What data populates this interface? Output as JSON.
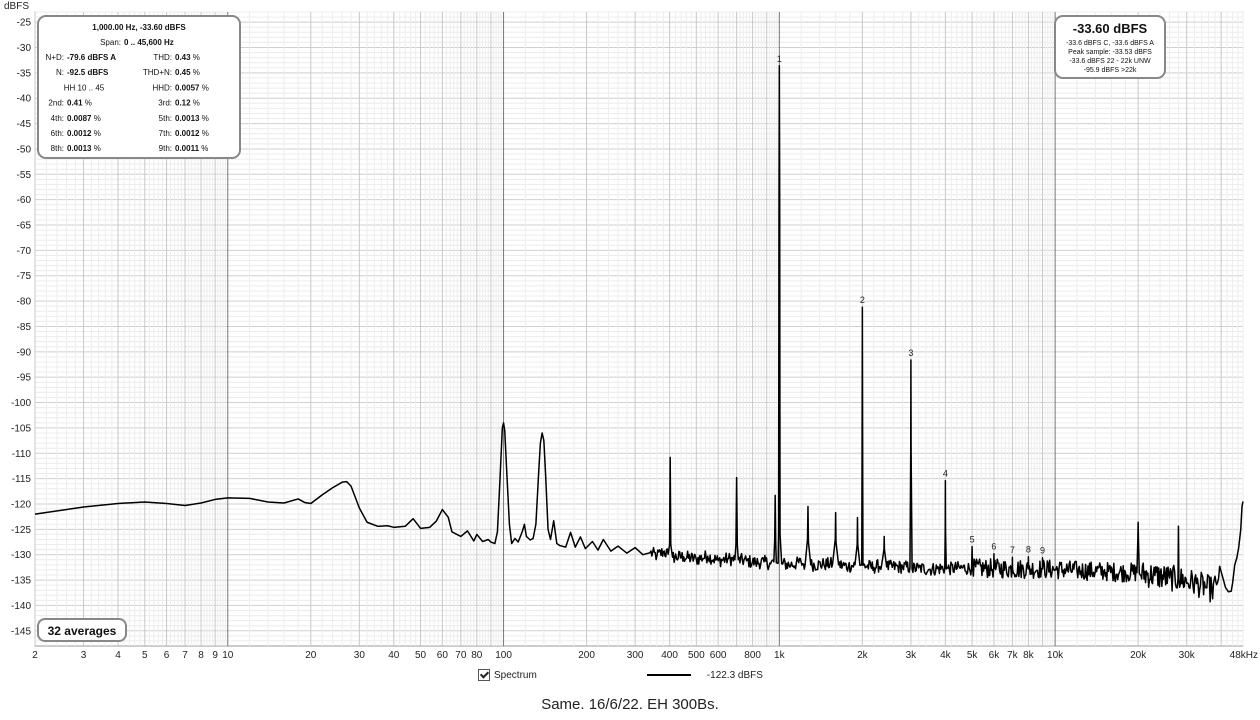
{
  "chart_data": {
    "type": "line",
    "yunit": "dBFS",
    "ylim": [
      -148,
      -23
    ],
    "xscale": "log",
    "xlim": [
      2,
      48000
    ],
    "yticks": [
      -25,
      -30,
      -35,
      -40,
      -45,
      -50,
      -55,
      -60,
      -65,
      -70,
      -75,
      -80,
      -85,
      -90,
      -95,
      -100,
      -105,
      -110,
      -115,
      -120,
      -125,
      -130,
      -135,
      -140,
      -145
    ],
    "xticks": [
      {
        "v": 2,
        "label": "2"
      },
      {
        "v": 3,
        "label": "3"
      },
      {
        "v": 4,
        "label": "4"
      },
      {
        "v": 5,
        "label": "5"
      },
      {
        "v": 6,
        "label": "6"
      },
      {
        "v": 7,
        "label": "7"
      },
      {
        "v": 8,
        "label": "8"
      },
      {
        "v": 9,
        "label": "9"
      },
      {
        "v": 10,
        "label": "10"
      },
      {
        "v": 20,
        "label": "20"
      },
      {
        "v": 30,
        "label": "30"
      },
      {
        "v": 40,
        "label": "40"
      },
      {
        "v": 50,
        "label": "50"
      },
      {
        "v": 60,
        "label": "60"
      },
      {
        "v": 70,
        "label": "70"
      },
      {
        "v": 80,
        "label": "80"
      },
      {
        "v": 100,
        "label": "100"
      },
      {
        "v": 200,
        "label": "200"
      },
      {
        "v": 300,
        "label": "300"
      },
      {
        "v": 400,
        "label": "400"
      },
      {
        "v": 500,
        "label": "500"
      },
      {
        "v": 600,
        "label": "600"
      },
      {
        "v": 800,
        "label": "800"
      },
      {
        "v": 1000,
        "label": "1k"
      },
      {
        "v": 2000,
        "label": "2k"
      },
      {
        "v": 3000,
        "label": "3k"
      },
      {
        "v": 4000,
        "label": "4k"
      },
      {
        "v": 5000,
        "label": "5k"
      },
      {
        "v": 6000,
        "label": "6k"
      },
      {
        "v": 7000,
        "label": "7k"
      },
      {
        "v": 8000,
        "label": "8k"
      },
      {
        "v": 10000,
        "label": "10k"
      },
      {
        "v": 20000,
        "label": "20k"
      },
      {
        "v": 30000,
        "label": "30k"
      },
      {
        "v": 48000,
        "label": "48kHz"
      }
    ],
    "grid": true,
    "series": [
      {
        "name": "Spectrum",
        "color": "#000000",
        "points": [
          [
            2,
            -122.0
          ],
          [
            3,
            -120.6
          ],
          [
            4,
            -119.9
          ],
          [
            5,
            -119.6
          ],
          [
            6,
            -119.9
          ],
          [
            7,
            -120.3
          ],
          [
            8,
            -119.8
          ],
          [
            9,
            -119.1
          ],
          [
            10,
            -118.8
          ],
          [
            12,
            -118.9
          ],
          [
            14,
            -119.6
          ],
          [
            16,
            -119.8
          ],
          [
            18,
            -119.0
          ],
          [
            19,
            -119.7
          ],
          [
            20,
            -119.9
          ],
          [
            22,
            -118.2
          ],
          [
            24,
            -116.8
          ],
          [
            26,
            -115.7
          ],
          [
            27,
            -115.6
          ],
          [
            28,
            -116.5
          ],
          [
            30,
            -120.8
          ],
          [
            32,
            -123.6
          ],
          [
            35,
            -124.4
          ],
          [
            38,
            -124.3
          ],
          [
            40,
            -124.6
          ],
          [
            44,
            -124.4
          ],
          [
            47,
            -122.9
          ],
          [
            50,
            -124.8
          ],
          [
            54,
            -124.6
          ],
          [
            57,
            -123.4
          ],
          [
            60,
            -121.1
          ],
          [
            63,
            -122.6
          ],
          [
            65,
            -125.5
          ],
          [
            70,
            -126.4
          ],
          [
            74,
            -125.3
          ],
          [
            78,
            -127.3
          ],
          [
            80,
            -126.0
          ],
          [
            84,
            -127.4
          ],
          [
            88,
            -127.0
          ],
          [
            90,
            -127.5
          ],
          [
            93,
            -127.8
          ],
          [
            95,
            -125.5
          ],
          [
            97,
            -115.5
          ],
          [
            99,
            -105.0
          ],
          [
            100,
            -104.0
          ],
          [
            101,
            -105.5
          ],
          [
            103,
            -115.0
          ],
          [
            105,
            -124.0
          ],
          [
            107,
            -127.8
          ],
          [
            110,
            -126.8
          ],
          [
            113,
            -127.5
          ],
          [
            117,
            -125.4
          ],
          [
            119,
            -124.0
          ],
          [
            121,
            -126.4
          ],
          [
            125,
            -127.1
          ],
          [
            128,
            -126.8
          ],
          [
            131,
            -124.0
          ],
          [
            134,
            -114.0
          ],
          [
            136,
            -108.0
          ],
          [
            138,
            -106.0
          ],
          [
            140,
            -107.5
          ],
          [
            142,
            -114.0
          ],
          [
            145,
            -125.0
          ],
          [
            148,
            -127.0
          ],
          [
            152,
            -123.3
          ],
          [
            156,
            -127.8
          ],
          [
            160,
            -128.2
          ],
          [
            168,
            -128.5
          ],
          [
            175,
            -125.6
          ],
          [
            182,
            -128.5
          ],
          [
            190,
            -126.5
          ],
          [
            198,
            -128.8
          ],
          [
            210,
            -127.4
          ],
          [
            220,
            -129.1
          ],
          [
            230,
            -127.0
          ],
          [
            245,
            -129.3
          ],
          [
            260,
            -128.3
          ],
          [
            280,
            -129.7
          ],
          [
            300,
            -128.6
          ],
          [
            320,
            -130.0
          ],
          [
            340,
            -129.6
          ],
          [
            360,
            -130.2
          ],
          [
            380,
            -129.4
          ],
          [
            395,
            -129.9
          ],
          [
            400,
            -128.0
          ],
          [
            402,
            -110.8
          ],
          [
            404,
            -128.0
          ],
          [
            410,
            -130.5
          ],
          [
            450,
            -130.4
          ],
          [
            500,
            -130.9
          ],
          [
            550,
            -130.3
          ],
          [
            600,
            -131.2
          ],
          [
            650,
            -130.8
          ],
          [
            690,
            -131.0
          ],
          [
            696,
            -128.0
          ],
          [
            700,
            -114.8
          ],
          [
            704,
            -128.0
          ],
          [
            710,
            -131.0
          ],
          [
            760,
            -131.2
          ],
          [
            820,
            -131.6
          ],
          [
            880,
            -131.4
          ],
          [
            930,
            -131.8
          ],
          [
            955,
            -131.4
          ],
          [
            962,
            -127.0
          ],
          [
            966,
            -118.3
          ],
          [
            970,
            -127.5
          ],
          [
            975,
            -131.6
          ],
          [
            990,
            -131.7
          ],
          [
            994,
            -125.0
          ],
          [
            997,
            -60.0
          ],
          [
            1000,
            -33.6
          ],
          [
            1003,
            -60.0
          ],
          [
            1006,
            -126.0
          ],
          [
            1020,
            -131.8
          ],
          [
            1100,
            -132.0
          ],
          [
            1200,
            -131.5
          ],
          [
            1240,
            -132.0
          ],
          [
            1265,
            -127.0
          ],
          [
            1270,
            -120.5
          ],
          [
            1275,
            -127.5
          ],
          [
            1300,
            -132.0
          ],
          [
            1450,
            -131.9
          ],
          [
            1560,
            -131.8
          ],
          [
            1595,
            -127.0
          ],
          [
            1600,
            -121.7
          ],
          [
            1605,
            -127.5
          ],
          [
            1640,
            -132.0
          ],
          [
            1780,
            -132.3
          ],
          [
            1880,
            -132.0
          ],
          [
            1915,
            -128.0
          ],
          [
            1920,
            -122.7
          ],
          [
            1925,
            -128.0
          ],
          [
            1960,
            -132.1
          ],
          [
            1990,
            -132.0
          ],
          [
            1995,
            -110.0
          ],
          [
            2000,
            -81.2
          ],
          [
            2005,
            -110.0
          ],
          [
            2010,
            -132.1
          ],
          [
            2200,
            -132.5
          ],
          [
            2350,
            -132.0
          ],
          [
            2395,
            -129.0
          ],
          [
            2400,
            -126.4
          ],
          [
            2405,
            -129.0
          ],
          [
            2450,
            -132.4
          ],
          [
            2800,
            -132.4
          ],
          [
            2975,
            -132.5
          ],
          [
            2995,
            -110.0
          ],
          [
            3000,
            -91.6
          ],
          [
            3005,
            -110.0
          ],
          [
            3030,
            -132.8
          ],
          [
            3200,
            -132.6
          ],
          [
            3500,
            -132.9
          ],
          [
            3980,
            -132.6
          ],
          [
            3995,
            -125.0
          ],
          [
            4000,
            -115.4
          ],
          [
            4005,
            -125.0
          ],
          [
            4030,
            -132.8
          ],
          [
            4500,
            -132.6
          ],
          [
            4980,
            -132.7
          ],
          [
            5000,
            -128.4
          ],
          [
            5020,
            -132.7
          ],
          [
            5990,
            -132.7
          ],
          [
            6000,
            -129.8
          ],
          [
            6010,
            -132.7
          ],
          [
            6990,
            -132.8
          ],
          [
            7000,
            -130.5
          ],
          [
            7010,
            -132.8
          ],
          [
            7990,
            -132.8
          ],
          [
            8000,
            -130.4
          ],
          [
            8010,
            -132.8
          ],
          [
            8990,
            -132.8
          ],
          [
            9000,
            -130.6
          ],
          [
            9010,
            -132.8
          ],
          [
            10000,
            -132.9
          ],
          [
            12000,
            -133.1
          ],
          [
            15000,
            -133.3
          ],
          [
            18000,
            -133.5
          ],
          [
            19800,
            -133.5
          ],
          [
            19950,
            -127.0
          ],
          [
            20000,
            -123.6
          ],
          [
            20050,
            -127.0
          ],
          [
            20200,
            -133.7
          ],
          [
            23000,
            -134.1
          ],
          [
            26000,
            -134.6
          ],
          [
            27900,
            -134.8
          ],
          [
            28000,
            -124.4
          ],
          [
            28100,
            -134.8
          ],
          [
            31000,
            -135.4
          ],
          [
            33000,
            -135.8
          ],
          [
            35000,
            -136.3
          ],
          [
            37000,
            -136.9
          ],
          [
            38500,
            -135.9
          ],
          [
            39500,
            -132.3
          ],
          [
            40500,
            -134.4
          ],
          [
            41500,
            -136.5
          ],
          [
            42500,
            -137.3
          ],
          [
            43500,
            -137.2
          ],
          [
            44000,
            -135.6
          ],
          [
            44800,
            -132.0
          ],
          [
            45600,
            -130.6
          ],
          [
            46300,
            -128.6
          ],
          [
            47100,
            -125.1
          ],
          [
            47600,
            -120.5
          ],
          [
            48000,
            -119.5
          ]
        ]
      }
    ],
    "harmonic_labels": [
      {
        "label": "1",
        "x": 1000,
        "y": -33.6
      },
      {
        "label": "2",
        "x": 2000,
        "y": -81.2
      },
      {
        "label": "3",
        "x": 3000,
        "y": -91.6
      },
      {
        "label": "4",
        "x": 4000,
        "y": -115.4
      },
      {
        "label": "5",
        "x": 5000,
        "y": -128.4
      },
      {
        "label": "6",
        "x": 6000,
        "y": -129.8
      },
      {
        "label": "7",
        "x": 7000,
        "y": -130.5
      },
      {
        "label": "8",
        "x": 8000,
        "y": -130.4
      },
      {
        "label": "9",
        "x": 9000,
        "y": -130.6
      }
    ]
  },
  "info_panel": {
    "title": "1,000.00 Hz, -33.60 dBFS",
    "span": {
      "label": "Span:",
      "value": "0 .. 45,600 Hz"
    },
    "rows": [
      {
        "l_label": "N+D:",
        "l_value": "-79.6 dBFS A",
        "r_label": "THD:",
        "r_value": "0.43",
        "r_unit": "%"
      },
      {
        "l_label": "N:",
        "l_value": "-92.5 dBFS",
        "r_label": "THD+N:",
        "r_value": "0.45",
        "r_unit": "%"
      },
      {
        "l_label": "HH 10 .. 45",
        "l_value": "",
        "r_label": "HHD:",
        "r_value": "0.0057",
        "r_unit": "%"
      },
      {
        "l_label": "2nd:",
        "l_value": "0.41",
        "l_unit": "%",
        "r_label": "3rd:",
        "r_value": "0.12",
        "r_unit": "%"
      },
      {
        "l_label": "4th:",
        "l_value": "0.0087",
        "l_unit": "%",
        "r_label": "5th:",
        "r_value": "0.0013",
        "r_unit": "%"
      },
      {
        "l_label": "6th:",
        "l_value": "0.0012",
        "l_unit": "%",
        "r_label": "7th:",
        "r_value": "0.0012",
        "r_unit": "%"
      },
      {
        "l_label": "8th:",
        "l_value": "0.0013",
        "l_unit": "%",
        "r_label": "9th:",
        "r_value": "0.0011",
        "r_unit": "%"
      }
    ]
  },
  "level_panel": {
    "level": "-33.60 dBFS",
    "lines": [
      "-33.6 dBFS C, -33.6 dBFS A",
      "Peak sample: -33.53 dBFS",
      "-33.6 dBFS 22 - 22k UNW",
      "-95.9 dBFS >22k"
    ]
  },
  "averages_badge": "32 averages",
  "legend": {
    "label": "Spectrum",
    "value": "-122.3 dBFS",
    "checked": true
  },
  "caption": "Same. 16/6/22. EH 300Bs."
}
